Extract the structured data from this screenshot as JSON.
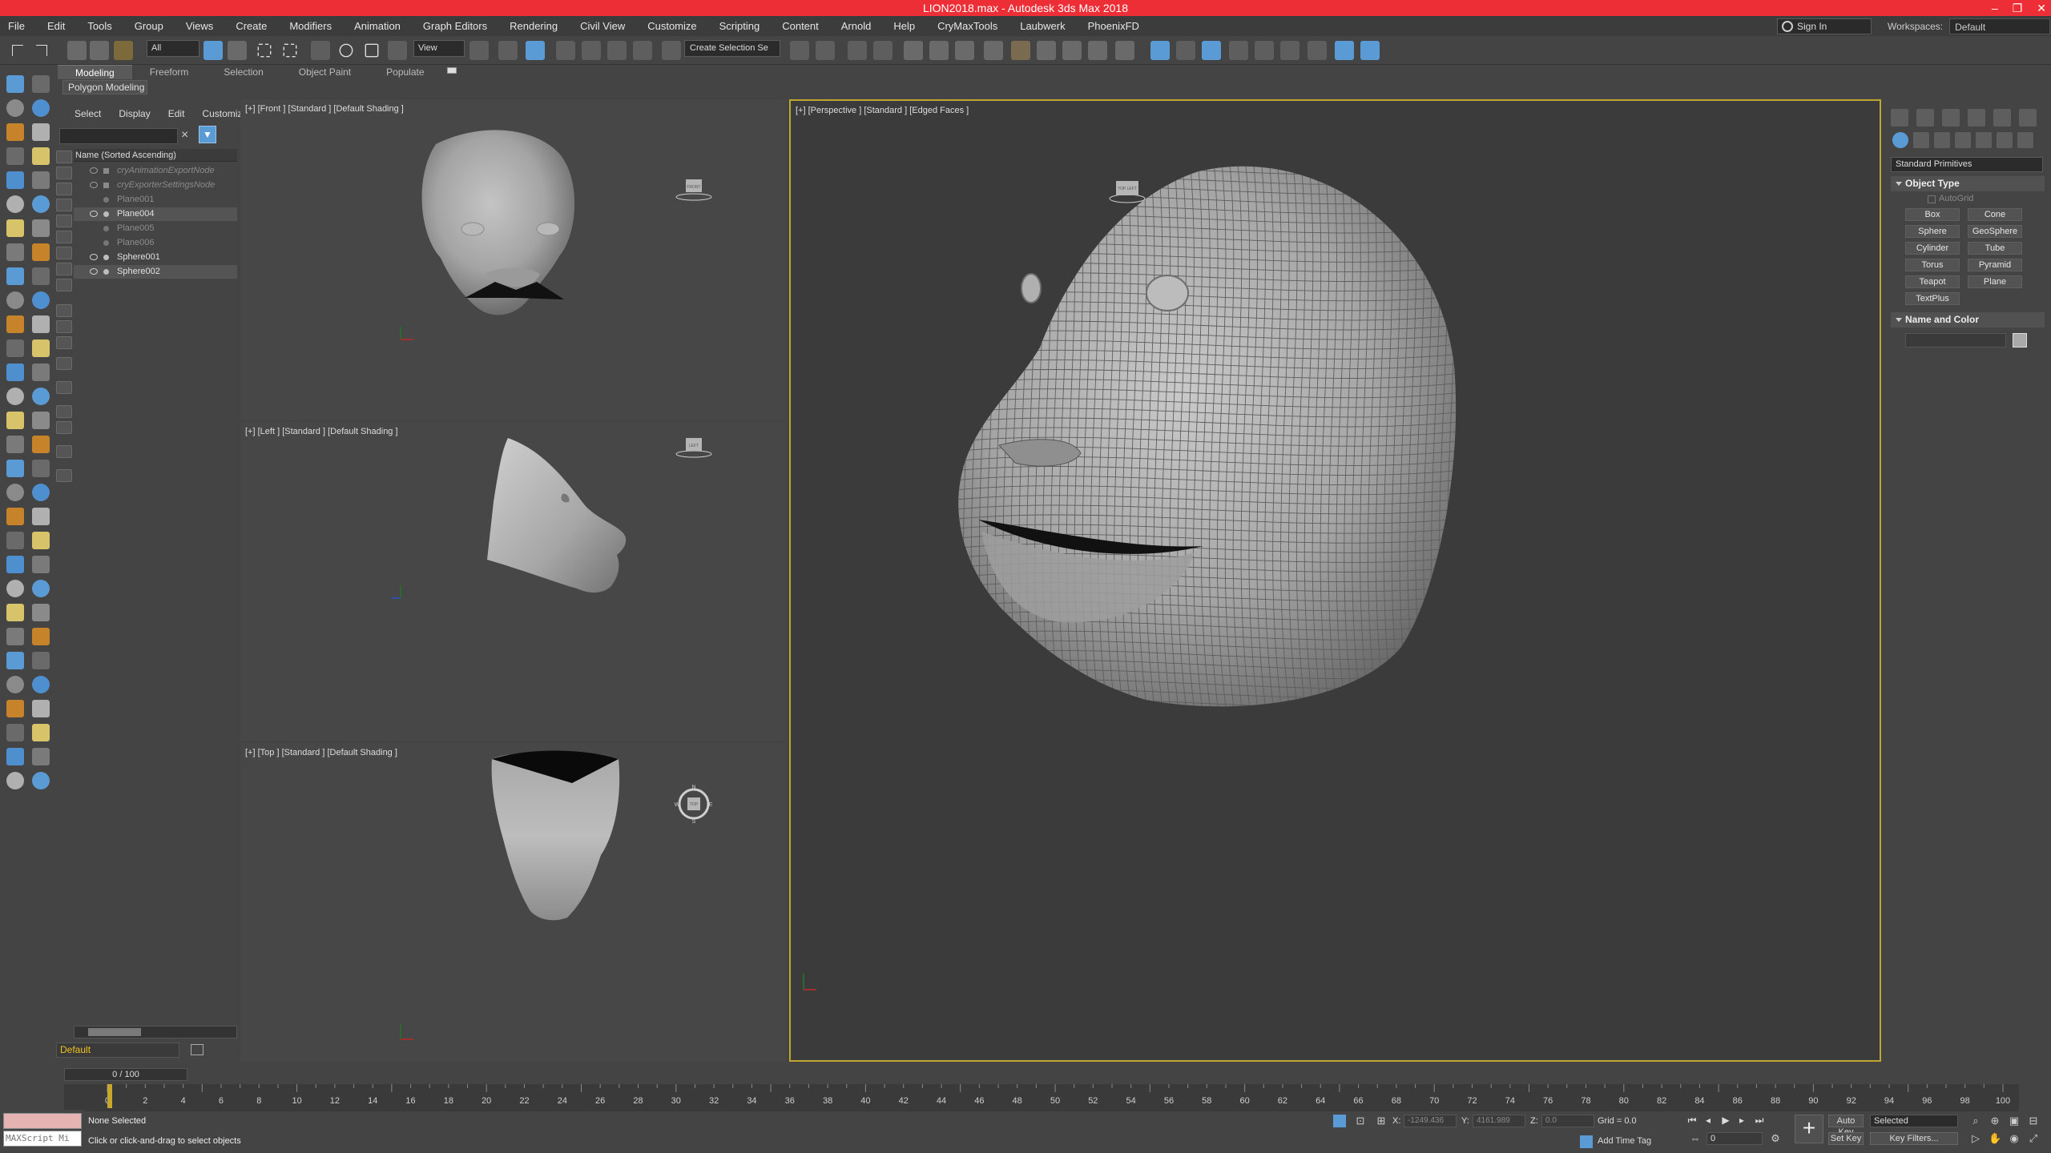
{
  "window": {
    "title": "LION2018.max - Autodesk 3ds Max 2018",
    "controls": [
      "–",
      "❐",
      "✕"
    ]
  },
  "menubar": {
    "items": [
      "File",
      "Edit",
      "Tools",
      "Group",
      "Views",
      "Create",
      "Modifiers",
      "Animation",
      "Graph Editors",
      "Rendering",
      "Civil View",
      "Customize",
      "Scripting",
      "Content",
      "Arnold",
      "Help",
      "CryMaxTools",
      "Laubwerk",
      "PhoenixFD"
    ],
    "sign_in": "Sign In",
    "workspaces_label": "Workspaces:",
    "workspaces_value": "Default"
  },
  "toolbar": {
    "selection_filter": "All",
    "reference_coord": "View",
    "named_selection": "Create Selection Se",
    "accent": "#5b9bd5"
  },
  "ribbon": {
    "tabs": [
      "Modeling",
      "Freeform",
      "Selection",
      "Object Paint",
      "Populate"
    ],
    "active_tab": "Modeling",
    "panel": "Polygon Modeling"
  },
  "scene_explorer": {
    "menu": [
      "Select",
      "Display",
      "Edit",
      "Customize"
    ],
    "column_header": "Name (Sorted Ascending)",
    "rows": [
      {
        "name": "cryAnimationExportNode",
        "style": "dim"
      },
      {
        "name": "cryExporterSettingsNode",
        "style": "dim"
      },
      {
        "name": "Plane001",
        "style": "hidden-obj"
      },
      {
        "name": "Plane004",
        "style": "visible"
      },
      {
        "name": "Plane005",
        "style": "hidden-obj"
      },
      {
        "name": "Plane006",
        "style": "hidden-obj"
      },
      {
        "name": "Sphere001",
        "style": "visible"
      },
      {
        "name": "Sphere002",
        "style": "visible"
      }
    ],
    "layer": "Default"
  },
  "viewports": {
    "front": {
      "plus": "[+]",
      "view": "[Front ]",
      "shading_a": "[Standard ]",
      "shading_b": "[Default Shading ]"
    },
    "left": {
      "plus": "[+]",
      "view": "[Left ]",
      "shading_a": "[Standard ]",
      "shading_b": "[Default Shading ]"
    },
    "top": {
      "plus": "[+]",
      "view": "[Top ]",
      "shading_a": "[Standard ]",
      "shading_b": "[Default Shading ]"
    },
    "perspective": {
      "plus": "[+]",
      "view": "[Perspective ]",
      "shading_a": "[Standard ]",
      "shading_b": "[Edged Faces ]"
    },
    "viewcube_labels": {
      "front": "FRONT",
      "left": "LEFT",
      "top": "TOP",
      "persp": "TOP LEFT"
    },
    "compass": {
      "n": "N",
      "s": "S",
      "e": "E",
      "w": "W"
    },
    "active_border": "#c0a630"
  },
  "command_panel": {
    "category": "Standard Primitives",
    "object_type_title": "Object Type",
    "autogrid": "AutoGrid",
    "primitives": [
      "Box",
      "Cone",
      "Sphere",
      "GeoSphere",
      "Cylinder",
      "Tube",
      "Torus",
      "Pyramid",
      "Teapot",
      "Plane",
      "TextPlus"
    ],
    "name_color_title": "Name and Color"
  },
  "timeline": {
    "slider": "0 / 100",
    "ticks": [
      0,
      2,
      4,
      6,
      8,
      10,
      12,
      14,
      16,
      18,
      20,
      22,
      24,
      26,
      28,
      30,
      32,
      34,
      36,
      38,
      40,
      42,
      44,
      46,
      48,
      50,
      52,
      54,
      56,
      58,
      60,
      62,
      64,
      66,
      68,
      70,
      72,
      74,
      76,
      78,
      80,
      82,
      84,
      86,
      88,
      90,
      92,
      94,
      96,
      98,
      100
    ],
    "current_frame": 0
  },
  "status": {
    "maxscript_placeholder": "MAXScript Mi",
    "line1": "None Selected",
    "line2": "Click or click-and-drag to select objects",
    "x_label": "X:",
    "x_value": "-1249.436",
    "y_label": "Y:",
    "y_value": "4161.989",
    "z_label": "Z:",
    "z_value": "0.0",
    "grid": "Grid = 0.0",
    "add_time_tag": "Add Time Tag",
    "auto_key": "Auto Key",
    "set_key": "Set Key",
    "selected": "Selected",
    "key_filters": "Key Filters...",
    "frame_value": "0"
  }
}
